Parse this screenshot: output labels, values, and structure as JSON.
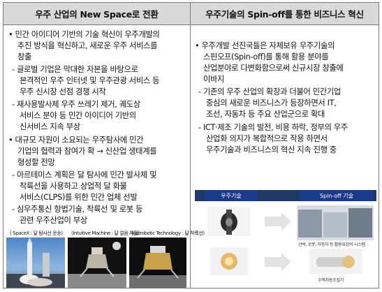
{
  "left": {
    "header": "우주 산업의 New Space로 전환",
    "paragraphs": [
      "• 민간 아이디어 기반의 기술 혁신이 우주개발의",
      "추진 방식을 혁신하고, 새로운 우주 서비스를",
      "창출",
      "- 글로벌 기업은 막대한 자본을 바탕으로",
      "본격적인 우주 인터넷 및 우주관광 서비스 등",
      "우주 신시장 선점 경쟁 시작",
      "- 재사용발사체 우주 쓰레기 제거, 궤도상",
      "서비스 분야 등 민간 아이디어 기반의",
      "신서비스 지속 부상",
      "• 대규모 자원이 소요되는 우주탐사에 민간",
      "기업의 협력과 참여가 확 → 신산업 생태계를",
      "형성할 전망",
      "- 아르테미스 계획은 달 탐사에 민간 발사체 및",
      "착륙선을 사용하고 상업적 달 화물",
      "서비스(CLPS)를 위한 민간 업체 선발",
      "- 심우주통신 항법기술, 착륙선 및 로봇 등",
      "관련 우주산업이 부상"
    ],
    "captions": [
      "( SpaceX : 달 탐사선 운송)",
      "(Intuitive Machine : 달 얼음 채굴)",
      "(Astrobotic Technology : 달 착륙선)"
    ]
  },
  "right": {
    "header": "우주기술의 Spin-off를 통한 비즈니스 혁신",
    "paragraphs": [
      "• 우주개발 선진국들은 자체보유 우주기술의",
      "스핀오프(Spin-off)를 통해 활용 분야를",
      "산업분야로 다변화함으로써 신규시장 창출에",
      "이바지",
      "- 기존의 우주 산업의 확장과 더불어 민간기업",
      "중심의 새로운 비즈니스가 등장하면서 IT,",
      "조선, 자동차 등 주요 산업군으로 확대",
      "- ICT·제조 기술의 발전, 비용 하락, 정부의 우주",
      "산업화 의지가 복합적으로 작용 하면서",
      "우주기술과 비즈니스의 혁신 지속 진행 중"
    ],
    "diagram": {
      "left_label": "우주기술",
      "right_label": "Spin-off 기술",
      "caption_top": "선박, 로봇, 자동차 등 활용요감의 시스템",
      "caption_bottom": "수액자동조절기"
    }
  }
}
